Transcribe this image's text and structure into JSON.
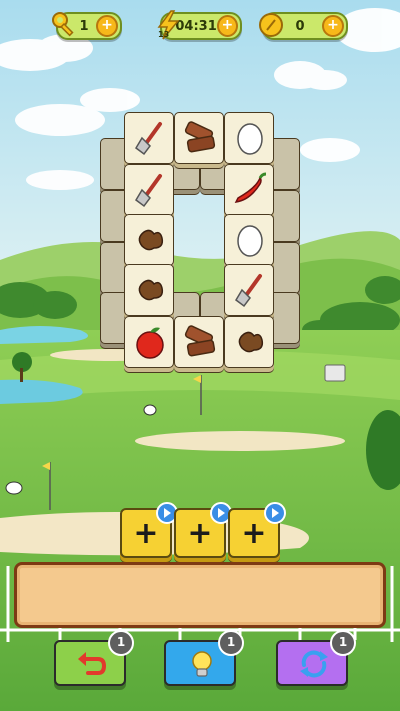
{
  "hud": {
    "keys": {
      "value": "1",
      "icon": "key-icon"
    },
    "energy": {
      "value": "04:31",
      "lightning_badge": "13",
      "icon": "lightning-icon"
    },
    "coins": {
      "value": "0",
      "icon": "coin-icon"
    },
    "plus_symbol": "+"
  },
  "boosters": [
    {
      "symbol": "+",
      "icon": "video-ad-icon"
    },
    {
      "symbol": "+",
      "icon": "video-ad-icon"
    },
    {
      "symbol": "+",
      "icon": "video-ad-icon"
    }
  ],
  "actions": {
    "undo": {
      "count": "1",
      "icon": "undo-icon",
      "color": "#8dd04a"
    },
    "hint": {
      "count": "1",
      "icon": "lightbulb-icon",
      "color": "#33a8ec"
    },
    "shuffle": {
      "count": "1",
      "icon": "shuffle-icon",
      "color": "#b46ff0"
    }
  },
  "tiles": [
    "shovel-icon",
    "wood-icon",
    "egg-icon",
    "shovel-icon",
    "chili-icon",
    "peanut-icon",
    "egg-icon",
    "peanut-icon",
    "shovel-icon",
    "apple-icon",
    "wood-icon",
    "peanut-icon"
  ],
  "colors": {
    "sky": "#bfe4f2",
    "grass": "#7cc04a",
    "tray": "#f4c98e"
  }
}
